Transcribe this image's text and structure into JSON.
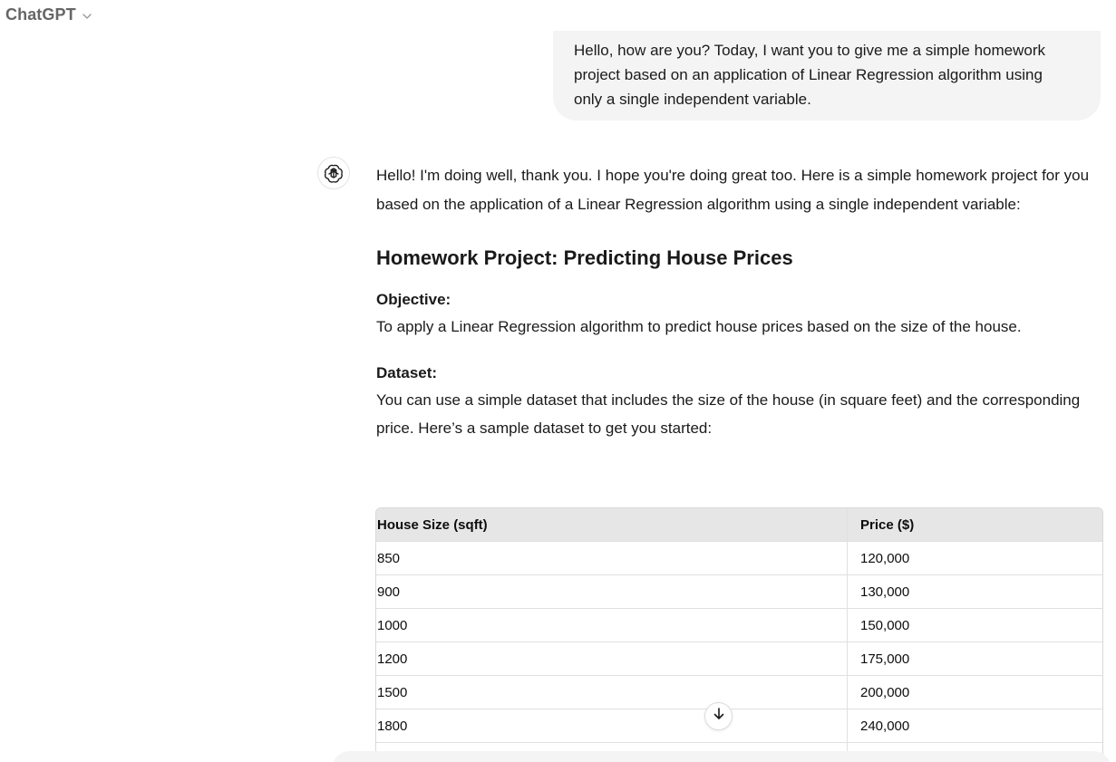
{
  "header": {
    "title": "ChatGPT",
    "dropdown_icon": "chevron-down-icon"
  },
  "user_message": {
    "text": "Hello, how are you? Today, I want you to give me a simple homework project based on an application of Linear Regression algorithm using only a single independent variable."
  },
  "assistant": {
    "avatar_icon": "openai-logo-icon",
    "intro": "Hello! I'm doing well, thank you. I hope you're doing great too. Here is a simple homework project for you based on the application of a Linear Regression algorithm using a single independent variable:",
    "heading": "Homework Project: Predicting House Prices",
    "objective_label": "Objective:",
    "objective_text": "To apply a Linear Regression algorithm to predict house prices based on the size of the house.",
    "dataset_label": "Dataset:",
    "dataset_text": "You can use a simple dataset that includes the size of the house (in square feet) and the corresponding price. Here’s a sample dataset to get you started:",
    "table": {
      "headers": [
        "House Size (sqft)",
        "Price ($)"
      ],
      "rows": [
        [
          "850",
          "120,000"
        ],
        [
          "900",
          "130,000"
        ],
        [
          "1000",
          "150,000"
        ],
        [
          "1200",
          "175,000"
        ],
        [
          "1500",
          "200,000"
        ],
        [
          "1800",
          "240,000"
        ],
        [
          "",
          ""
        ]
      ]
    }
  },
  "scroll_button": {
    "icon": "arrow-down-icon"
  }
}
